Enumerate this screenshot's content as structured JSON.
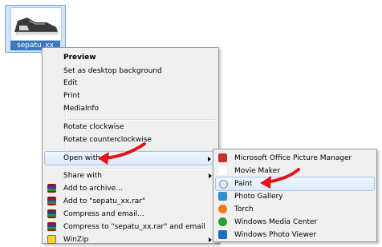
{
  "desktop": {
    "file_name": "sepatu_xx"
  },
  "context_menu": {
    "items": [
      {
        "label": "Preview",
        "bold": true
      },
      {
        "label": "Set as desktop background"
      },
      {
        "label": "Edit"
      },
      {
        "label": "Print"
      },
      {
        "label": "MediaInfo"
      },
      {
        "label": "Rotate clockwise"
      },
      {
        "label": "Rotate counterclockwise"
      },
      {
        "label": "Open with",
        "submenu": true
      },
      {
        "label": "Share with",
        "submenu": true
      },
      {
        "label": "Add to archive...",
        "icon": "winrar-icon"
      },
      {
        "label": "Add to \"sepatu_xx.rar\"",
        "icon": "winrar-icon"
      },
      {
        "label": "Compress and email...",
        "icon": "winrar-icon"
      },
      {
        "label": "Compress to \"sepatu_xx.rar\" and email",
        "icon": "winrar-icon"
      },
      {
        "label": "WinZip",
        "icon": "winzip-icon",
        "submenu": true
      }
    ]
  },
  "open_with_menu": {
    "items": [
      {
        "label": "Microsoft Office Picture Manager",
        "icon": "picture-manager-icon"
      },
      {
        "label": "Movie Maker",
        "icon": "movie-maker-icon"
      },
      {
        "label": "Paint",
        "icon": "paint-icon"
      },
      {
        "label": "Photo Gallery",
        "icon": "photo-gallery-icon"
      },
      {
        "label": "Torch",
        "icon": "torch-icon"
      },
      {
        "label": "Windows Media Center",
        "icon": "media-center-icon"
      },
      {
        "label": "Windows Photo Viewer",
        "icon": "photo-viewer-icon"
      }
    ]
  },
  "colors": {
    "highlight": "#dbe9fb",
    "annotation_arrow": "#e3151a",
    "selection_tile": "#cfe3f6"
  }
}
